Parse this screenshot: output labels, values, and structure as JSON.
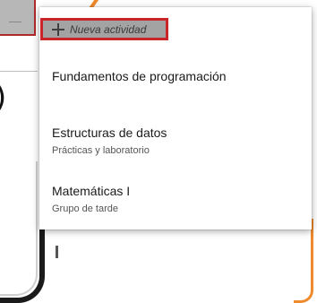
{
  "menu": {
    "new_activity": {
      "label": "Nueva actividad",
      "icon": "plus-icon"
    },
    "items": [
      {
        "title": "Fundamentos de programación",
        "subtitle": ""
      },
      {
        "title": "Estructuras de datos",
        "subtitle": "Prácticas y laboratorio"
      },
      {
        "title": "Matemáticas I",
        "subtitle": "Grupo de tarde"
      }
    ]
  },
  "colors": {
    "highlight_border": "#c8262a",
    "accent_orange": "#ef8a2d",
    "new_activity_bg": "#a3a3a3"
  }
}
